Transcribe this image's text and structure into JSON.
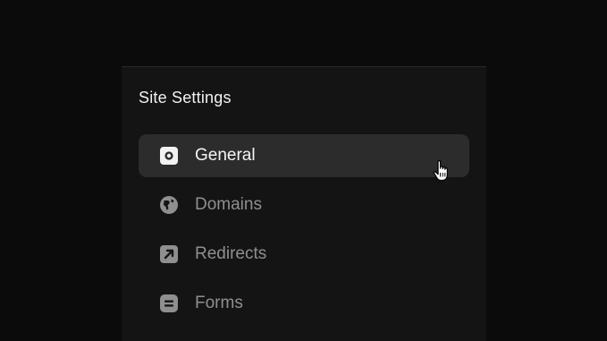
{
  "panel": {
    "title": "Site Settings"
  },
  "nav": {
    "items": [
      {
        "label": "General",
        "icon": "settings-square-icon",
        "active": true
      },
      {
        "label": "Domains",
        "icon": "globe-icon",
        "active": false
      },
      {
        "label": "Redirects",
        "icon": "arrow-up-right-square-icon",
        "active": false
      },
      {
        "label": "Forms",
        "icon": "form-square-icon",
        "active": false
      }
    ]
  },
  "colors": {
    "background": "#0b0b0b",
    "panel": "#141414",
    "active_item": "#2c2c2c",
    "text_active": "#f5f5f5",
    "text_inactive": "#8f8f8f"
  }
}
